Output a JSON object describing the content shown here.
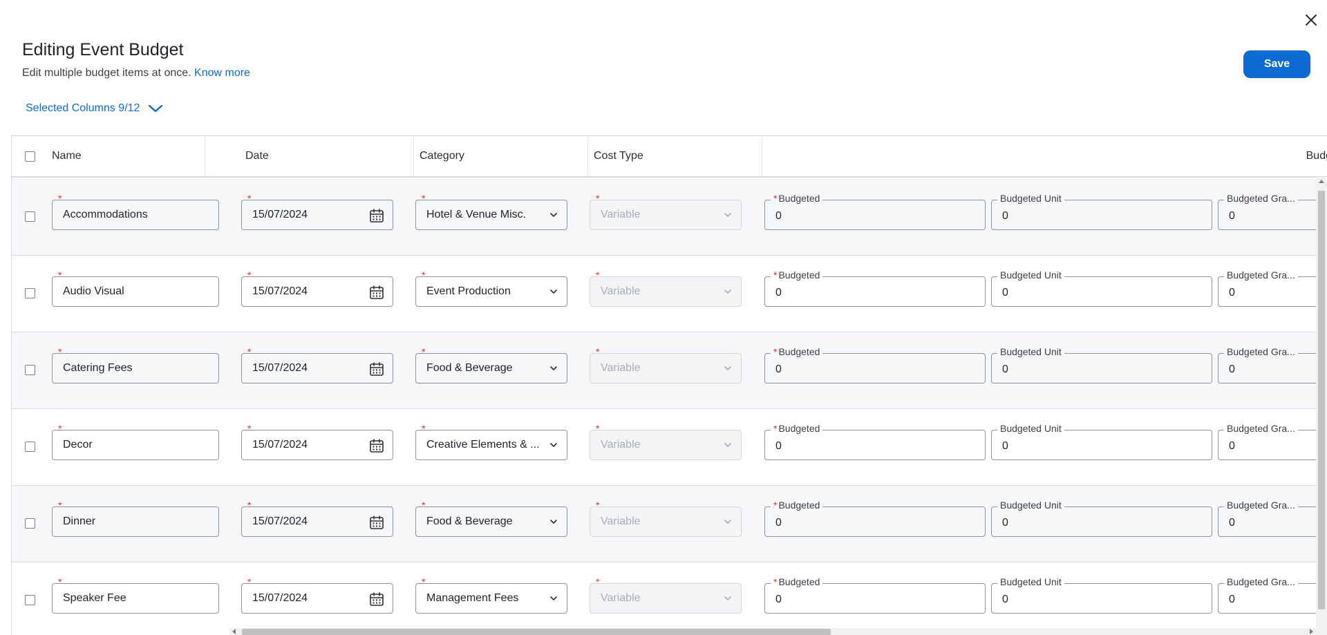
{
  "dialog": {
    "title": "Editing Event Budget",
    "subtitle": "Edit multiple budget items at once.",
    "know_more": "Know more",
    "save_label": "Save",
    "close_icon": "close-icon"
  },
  "columns_toggle": {
    "label": "Selected Columns 9/12",
    "icon": "chevron-down-icon"
  },
  "table": {
    "headers": {
      "name": "Name",
      "date": "Date",
      "category": "Category",
      "cost_type": "Cost Type",
      "budget_group": "Budg"
    },
    "field_labels": {
      "budgeted": "Budgeted",
      "budgeted_unit": "Budgeted Unit",
      "budgeted_grand": "Budgeted Gra..."
    },
    "rows": [
      {
        "name": "Accommodations",
        "date": "15/07/2024",
        "category": "Hotel & Venue Misc.",
        "cost_type": "Variable",
        "budgeted": "0",
        "budgeted_unit": "0",
        "budgeted_grand": "0"
      },
      {
        "name": "Audio Visual",
        "date": "15/07/2024",
        "category": "Event Production",
        "cost_type": "Variable",
        "budgeted": "0",
        "budgeted_unit": "0",
        "budgeted_grand": "0"
      },
      {
        "name": "Catering Fees",
        "date": "15/07/2024",
        "category": "Food & Beverage",
        "cost_type": "Variable",
        "budgeted": "0",
        "budgeted_unit": "0",
        "budgeted_grand": "0"
      },
      {
        "name": "Decor",
        "date": "15/07/2024",
        "category": "Creative Elements & ...",
        "cost_type": "Variable",
        "budgeted": "0",
        "budgeted_unit": "0",
        "budgeted_grand": "0"
      },
      {
        "name": "Dinner",
        "date": "15/07/2024",
        "category": "Food & Beverage",
        "cost_type": "Variable",
        "budgeted": "0",
        "budgeted_unit": "0",
        "budgeted_grand": "0"
      },
      {
        "name": "Speaker Fee",
        "date": "15/07/2024",
        "category": "Management Fees",
        "cost_type": "Variable",
        "budgeted": "0",
        "budgeted_unit": "0",
        "budgeted_grand": "0"
      }
    ]
  },
  "colors": {
    "accent": "#0b6bd3",
    "required": "#d93025",
    "row_alt": "#f6f7f9"
  }
}
